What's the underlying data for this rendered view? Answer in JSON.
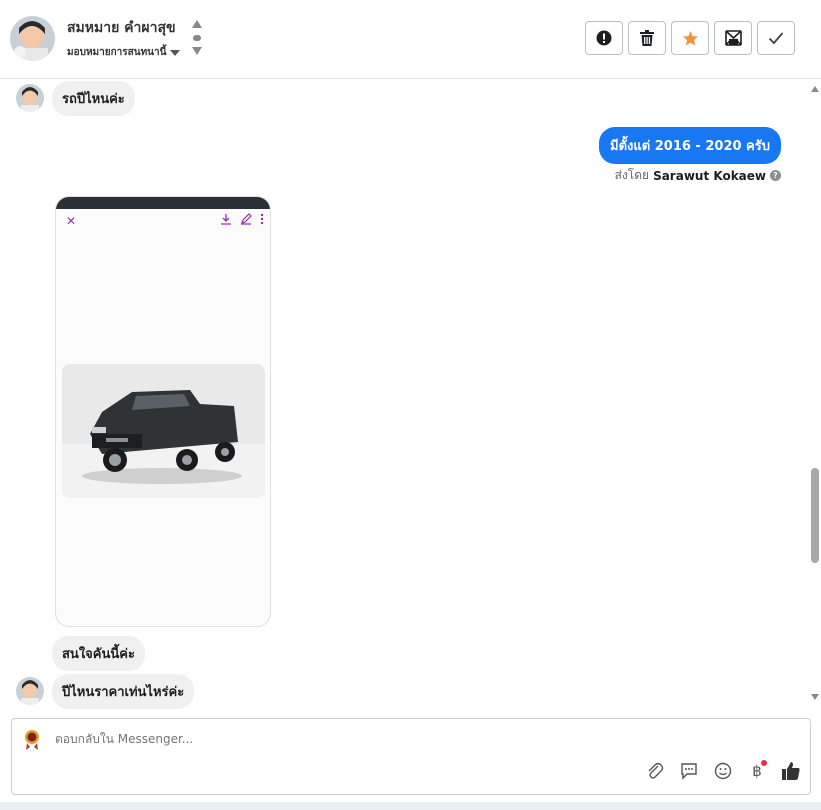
{
  "header": {
    "contact_name": "สมหมาย คำผาสุข",
    "assign_label": "มอบหมายการสนทนานี้",
    "actions": [
      {
        "name": "mark-spam-button",
        "icon": "alert-circle-icon"
      },
      {
        "name": "delete-button",
        "icon": "trash-icon"
      },
      {
        "name": "star-button",
        "icon": "star-icon",
        "color": "#f7923b"
      },
      {
        "name": "mark-unread-button",
        "icon": "envelope-icon"
      },
      {
        "name": "mark-done-button",
        "icon": "check-icon"
      }
    ]
  },
  "messages": [
    {
      "direction": "in",
      "text": "รถปีไหนค่ะ"
    },
    {
      "direction": "out",
      "text": "มีตั้งแต่ 2016 - 2020 ครับ"
    },
    {
      "sent_by_prefix": "ส่งโดย",
      "sent_by_name": "Sarawut Kokaew"
    },
    {
      "direction": "in",
      "type": "image",
      "description": "dark-gray pickup truck"
    },
    {
      "direction": "in",
      "text": "สนใจคันนี้ค่ะ"
    },
    {
      "direction": "in",
      "text": "ปีไหนราคาเท่นไหร่ค่ะ"
    }
  ],
  "composer": {
    "placeholder": "ตอบกลับใน Messenger...",
    "tools": [
      "paperclip-icon",
      "chat-bubble-icon",
      "smiley-icon",
      "baht-icon",
      "thumbs-up-icon"
    ]
  },
  "colors": {
    "outgoing_bubble": "#1877f2",
    "incoming_bubble": "#f0f0f0",
    "star": "#f7923b",
    "notification_dot": "#f02849"
  }
}
